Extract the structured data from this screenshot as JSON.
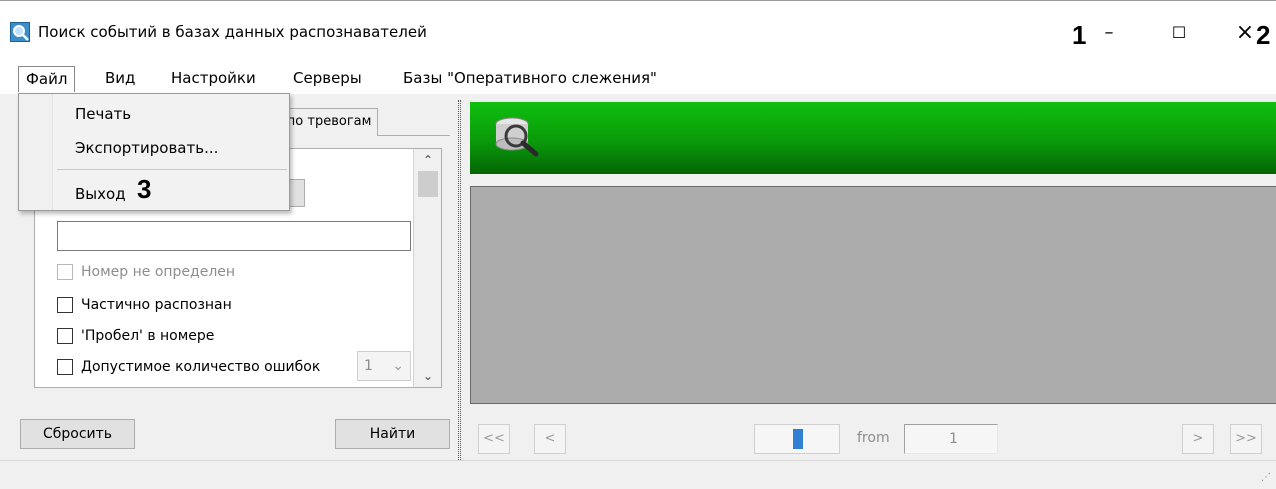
{
  "window": {
    "title": "Поиск событий в базах данных распознавателей",
    "icon": "search-app-icon",
    "minimize_label": "–",
    "maximize_label": "☐",
    "close_label": "×"
  },
  "annotations": {
    "a1": "1",
    "a2": "2",
    "a3": "3"
  },
  "menu": {
    "file": "Файл",
    "view": "Вид",
    "settings": "Настройки",
    "servers": "Серверы",
    "databases": "Базы \"Оперативного слежения\""
  },
  "file_menu": {
    "print": "Печать",
    "export": "Экспортировать...",
    "exit": "Выход"
  },
  "left_panel": {
    "alarm_tab": "ь по тревогам",
    "search_value": "",
    "checkboxes": {
      "not_determined": "Номер не определен",
      "partial": "Частично распознан",
      "space": "'Пробел' в номере",
      "errors": "Допустимое количество ошибок"
    },
    "errors_count": "1",
    "reset_button": "Сбросить",
    "find_button": "Найти"
  },
  "pager": {
    "first": "<<",
    "prev": "<",
    "from_label": "from",
    "page": "1",
    "next": ">",
    "last": ">>"
  },
  "colors": {
    "banner_green": "#0aa80a",
    "viewer_gray": "#acacac",
    "progress_blue": "#2f7fd3"
  }
}
